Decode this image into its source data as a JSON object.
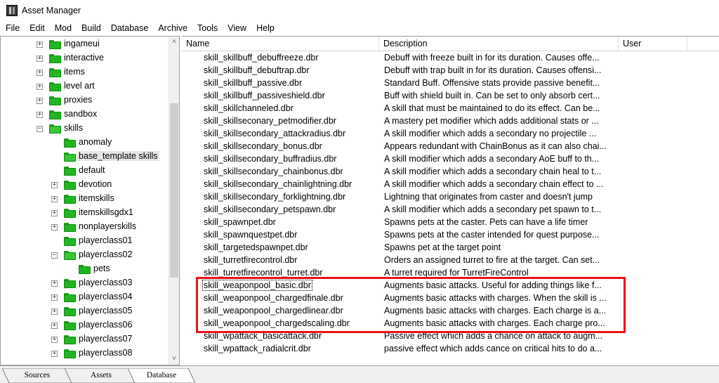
{
  "window": {
    "title": "Asset Manager"
  },
  "menu": [
    "File",
    "Edit",
    "Mod",
    "Build",
    "Database",
    "Archive",
    "Tools",
    "View",
    "Help"
  ],
  "tree": {
    "items": [
      {
        "label": "ingameui",
        "expander": "+"
      },
      {
        "label": "interactive",
        "expander": "+"
      },
      {
        "label": "items",
        "expander": "+"
      },
      {
        "label": "level art",
        "expander": "+"
      },
      {
        "label": "proxies",
        "expander": "+"
      },
      {
        "label": "sandbox",
        "expander": "+"
      },
      {
        "label": "skills",
        "expander": "−"
      },
      {
        "label": "anomaly",
        "expander": ""
      },
      {
        "label": "base_template skills",
        "expander": ""
      },
      {
        "label": "default",
        "expander": ""
      },
      {
        "label": "devotion",
        "expander": "+"
      },
      {
        "label": "itemskills",
        "expander": "+"
      },
      {
        "label": "itemskillsgdx1",
        "expander": "+"
      },
      {
        "label": "nonplayerskills",
        "expander": "+"
      },
      {
        "label": "playerclass01",
        "expander": ""
      },
      {
        "label": "playerclass02",
        "expander": "−"
      },
      {
        "label": "pets",
        "expander": ""
      },
      {
        "label": "playerclass03",
        "expander": "+"
      },
      {
        "label": "playerclass04",
        "expander": "+"
      },
      {
        "label": "playerclass05",
        "expander": "+"
      },
      {
        "label": "playerclass06",
        "expander": "+"
      },
      {
        "label": "playerclass07",
        "expander": "+"
      },
      {
        "label": "playerclass08",
        "expander": "+"
      }
    ],
    "selected": "base_template skills"
  },
  "list": {
    "columns": [
      "Name",
      "Description",
      "User"
    ],
    "rows": [
      {
        "name": "skill_skillbuff_debuffreeze.dbr",
        "desc": "Debuff with freeze built in for its duration. Causes offe..."
      },
      {
        "name": "skill_skillbuff_debuftrap.dbr",
        "desc": "Debuff with trap built in for its duration. Causes offensi..."
      },
      {
        "name": "skill_skillbuff_passive.dbr",
        "desc": "Standard Buff. Offensive stats provide passive benefit..."
      },
      {
        "name": "skill_skillbuff_passiveshield.dbr",
        "desc": "Buff with shield built in. Can be set to only absorb cert..."
      },
      {
        "name": "skill_skillchanneled.dbr",
        "desc": "A skill that must be maintained to do its effect. Can be..."
      },
      {
        "name": "skill_skillseconary_petmodifier.dbr",
        "desc": "A mastery pet modifier which adds additional stats or ..."
      },
      {
        "name": "skill_skillsecondary_attackradius.dbr",
        "desc": "A skill modifier which adds a secondary no projectile ..."
      },
      {
        "name": "skill_skillsecondary_bonus.dbr",
        "desc": "Appears redundant with ChainBonus as it can also chai..."
      },
      {
        "name": "skill_skillsecondary_buffradius.dbr",
        "desc": "A skill modifier which adds a secondary AoE buff to th..."
      },
      {
        "name": "skill_skillsecondary_chainbonus.dbr",
        "desc": "A skill modifier which adds a secondary chain heal to t..."
      },
      {
        "name": "skill_skillsecondary_chainlightning.dbr",
        "desc": "A skill modifier which adds a secondary chain effect to ..."
      },
      {
        "name": "skill_skillsecondary_forklightning.dbr",
        "desc": "Lightning that originates from caster and doesn't jump"
      },
      {
        "name": "skill_skillsecondary_petspawn.dbr",
        "desc": "A skill modifier which adds a secondary pet spawn to t..."
      },
      {
        "name": "skill_spawnpet.dbr",
        "desc": "Spawns pets at the caster. Pets can have a life timer"
      },
      {
        "name": "skill_spawnquestpet.dbr",
        "desc": "Spawns pets at the caster intended for quest purpose..."
      },
      {
        "name": "skill_targetedspawnpet.dbr",
        "desc": "Spawns pet at the target point"
      },
      {
        "name": "skill_turretfirecontrol.dbr",
        "desc": "Orders an assigned turret to fire at the target. Can set..."
      },
      {
        "name": "skill_turretfirecontrol_turret.dbr",
        "desc": "A turret required for TurretFireControl"
      },
      {
        "name": "skill_weaponpool_basic.dbr",
        "desc": "Augments basic attacks. Useful for adding things like f..."
      },
      {
        "name": "skill_weaponpool_chargedfinale.dbr",
        "desc": "Augments basic attacks with charges. When the skill is ..."
      },
      {
        "name": "skill_weaponpool_chargedlinear.dbr",
        "desc": "Augments basic attacks with charges. Each charge is a..."
      },
      {
        "name": "skill_weaponpool_chargedscaling.dbr",
        "desc": "Augments basic attacks with charges. Each charge pro..."
      },
      {
        "name": "skill_wpattack_basicattack.dbr",
        "desc": "Passive effect which adds a chance on attack to augm..."
      },
      {
        "name": "skill_wpattack_radialcrit.dbr",
        "desc": "passive effect which adds cance on critical hits to do a..."
      }
    ],
    "focused_row": "skill_weaponpool_basic.dbr"
  },
  "tabs": [
    "Sources",
    "Assets",
    "Database"
  ],
  "active_tab": "Database",
  "colors": {
    "highlight": "#e8141b",
    "folder": "#22b522"
  }
}
